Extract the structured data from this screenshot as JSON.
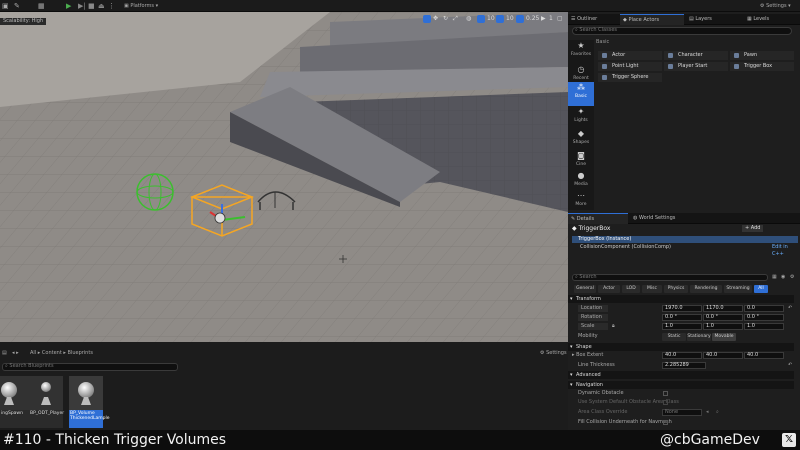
{
  "topbar": {
    "platforms_label": "Platforms",
    "settings_label": "Settings"
  },
  "viewport": {
    "lod_badge": "Scalability: High",
    "snap_angle": "10",
    "snap_scale": "0.25",
    "camera_speed": "1",
    "colors": {
      "floor": "#8f8b87",
      "wall": "#5d5d63",
      "gizmo": "#f5a623",
      "sphere": "#3bbf2e"
    }
  },
  "outliner": {
    "tabs": [
      "Outliner",
      "Place Actors",
      "Layers",
      "Levels"
    ]
  },
  "place_actors": {
    "search_placeholder": "Search Classes",
    "group_label": "Basic",
    "categories": [
      "Favorites",
      "Recent",
      "Basic",
      "Lights",
      "Shapes",
      "Cine",
      "Media",
      "More"
    ],
    "actors": [
      "Actor",
      "Character",
      "Pawn",
      "Point Light",
      "Player Start",
      "Trigger Box",
      "Trigger Sphere"
    ]
  },
  "details": {
    "tabs": [
      "Details",
      "World Settings"
    ],
    "actor_name": "TriggerBox",
    "add_label": "+ Add",
    "instance_label": "TriggerBox (Instance)",
    "component_label": "CollisionComponent (CollisionComp)",
    "edit_in_cpp": "Edit in C++",
    "search_placeholder": "Search",
    "filter_tabs": [
      "General",
      "Actor",
      "LOD",
      "Misc",
      "Physics",
      "Rendering",
      "Streaming",
      "All"
    ],
    "transform": {
      "section": "Transform",
      "location_label": "Location",
      "location": [
        "1970.0",
        "1170.0",
        "0.0"
      ],
      "rotation_label": "Rotation",
      "rotation": [
        "0.0 °",
        "0.0 °",
        "0.0 °"
      ],
      "scale_label": "Scale",
      "scale": [
        "1.0",
        "1.0",
        "1.0"
      ],
      "mobility_label": "Mobility",
      "mobility_options": [
        "Static",
        "Stationary",
        "Movable"
      ]
    },
    "shape": {
      "section": "Shape",
      "box_extent_label": "Box Extent",
      "box_extent": [
        "40.0",
        "40.0",
        "40.0"
      ],
      "line_thickness_label": "Line Thickness",
      "line_thickness": "2.285289"
    },
    "advanced_label": "Advanced",
    "navigation": {
      "section": "Navigation",
      "dynamic_obstacle": "Dynamic Obstacle",
      "use_system_default": "Use System Default Obstacle Area Class",
      "area_class_override": "Area Class Override",
      "area_class_value": "None",
      "fill_collision": "Fill Collision Underneath for Navmesh"
    }
  },
  "content_browser": {
    "path": [
      "All",
      "Content",
      "Blueprints"
    ],
    "settings_label": "Settings",
    "search_placeholder": "Search Blueprints",
    "assets": [
      {
        "name": "ingSpawn"
      },
      {
        "name": "BP_ODT_Player"
      },
      {
        "name": "BP_Volume\nThickenedLample"
      }
    ]
  },
  "banner": {
    "title": "#110 - Thicken Trigger Volumes",
    "handle": "@cbGameDev",
    "x_glyph": "𝕏"
  }
}
